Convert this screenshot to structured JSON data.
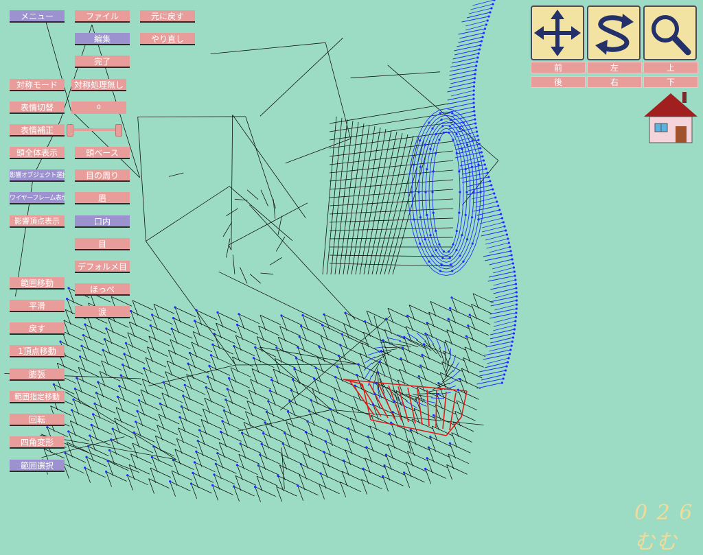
{
  "toolbar": {
    "menu": "メニュー",
    "file": "ファイル",
    "undo": "元に戻す",
    "edit": "編集",
    "redo": "やり直し",
    "done": "完了"
  },
  "left_menu": {
    "symmetry_mode": "対称モード",
    "symmetry_value": "対称処理無し",
    "expression_switch": "表情切替",
    "expression_value": "0",
    "expression_correct": "表情補正",
    "head_full_view": "頭全体表示",
    "head_base": "頭ベース",
    "influence_object_select": "影響オブジェクト選択",
    "around_eyes": "目の周り",
    "wireframe_view": "ワイヤーフレーム表示",
    "eyebrow": "眉",
    "influence_vertex_view": "影響頂点表示",
    "mouth_inside": "口内",
    "eye": "目",
    "deformed_eye": "デフォルメ目",
    "cheek": "ほっぺ",
    "tear": "涙",
    "range_move": "範囲移動",
    "smooth": "平滑",
    "revert": "戻す",
    "one_vertex_move": "1頂点移動",
    "inflate": "膨張",
    "range_specified_move": "範囲指定移動",
    "rotate": "回転",
    "quad_deform": "四角変形",
    "range_select": "範囲選択"
  },
  "view": {
    "nav_icons": [
      "move-arrows-icon",
      "rotate-arrows-icon",
      "magnifier-icon"
    ],
    "front": "前",
    "left": "左",
    "top": "上",
    "back": "後",
    "right": "右",
    "bottom": "下",
    "home_icon": "house-icon"
  },
  "logo": "0 2 6 むむ",
  "colors": {
    "background": "#9cdcc4",
    "button_pink": "#e89d9b",
    "button_lavender": "#9b92cf",
    "wire_black": "#111111",
    "wire_blue": "#1f2bff",
    "wire_red": "#e01a1a"
  }
}
